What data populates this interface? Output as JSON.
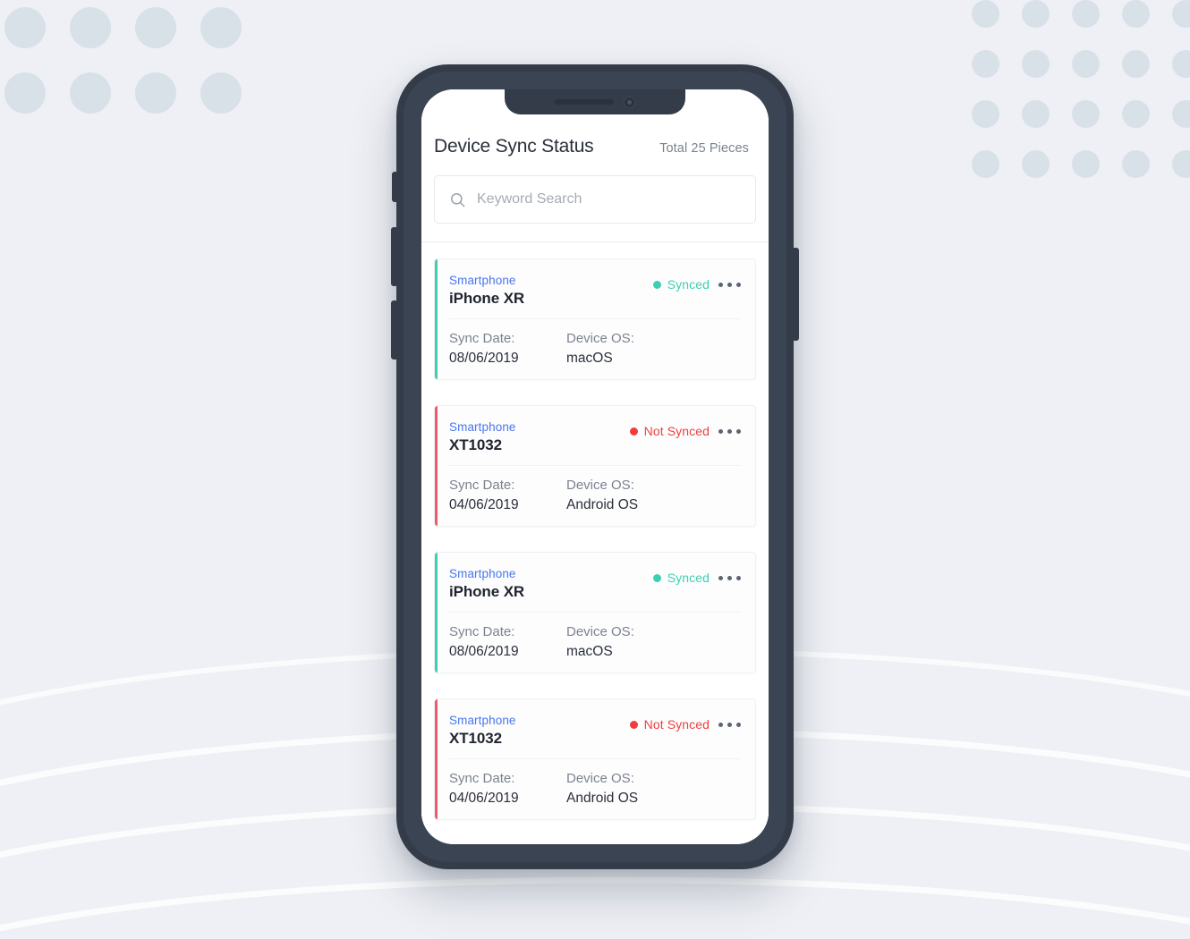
{
  "app": {
    "header": {
      "title": "Device Sync Status",
      "total": "Total 25 Pieces"
    },
    "search": {
      "placeholder": "Keyword Search",
      "value": "",
      "icon": "search-icon"
    },
    "meta_labels": {
      "sync_date": "Sync Date:",
      "device_os": "Device OS:"
    },
    "more_icon": "ellipsis-horizontal-icon",
    "cards": [
      {
        "type": "Smartphone",
        "name": "iPhone XR",
        "status": "Synced",
        "status_color": "#3ecfb2",
        "accent_color": "#3ecfb2",
        "sync_date": "08/06/2019",
        "device_os": "macOS"
      },
      {
        "type": "Smartphone",
        "name": "XT1032",
        "status": "Not Synced",
        "status_color": "#ef3e3e",
        "accent_color": "#ef5b6b",
        "sync_date": "04/06/2019",
        "device_os": "Android OS"
      },
      {
        "type": "Smartphone",
        "name": "iPhone XR",
        "status": "Synced",
        "status_color": "#3ecfb2",
        "accent_color": "#3ecfb2",
        "sync_date": "08/06/2019",
        "device_os": "macOS"
      },
      {
        "type": "Smartphone",
        "name": "XT1032",
        "status": "Not Synced",
        "status_color": "#ef3e3e",
        "accent_color": "#ef5b6b",
        "sync_date": "04/06/2019",
        "device_os": "Android OS"
      }
    ]
  },
  "colors": {
    "page_background": "#eef0f5",
    "phone_body": "#343c49",
    "dot_pattern": "#d8e1e7",
    "accent_blue": "#4876ef",
    "status_synced": "#3ecfb2",
    "status_not_synced": "#ef3e3e"
  },
  "decoration": {
    "dot_grid_left": {
      "columns": 4,
      "rows": 2
    },
    "dot_grid_right": {
      "columns": 5,
      "rows": 4
    }
  }
}
